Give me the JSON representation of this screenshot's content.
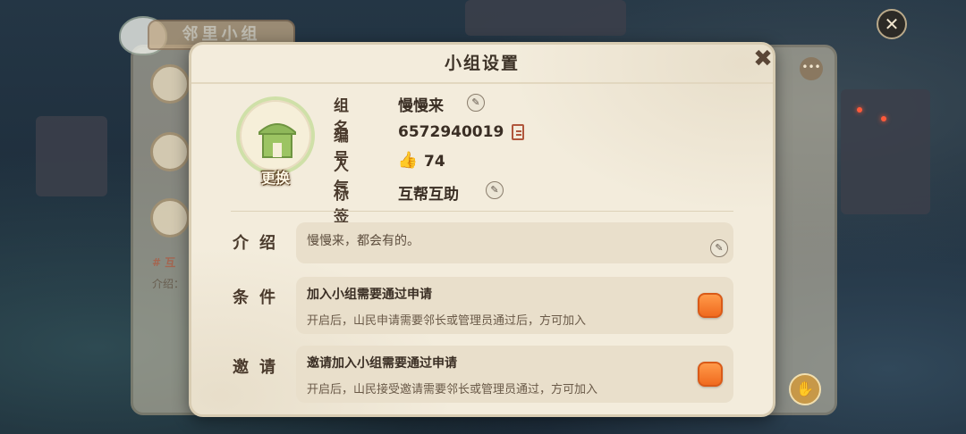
{
  "background": {
    "group_tab_label": "邻里小组",
    "partial_tag": "# 互",
    "partial_intro_label": "介绍："
  },
  "dialog": {
    "title": "小组设置",
    "avatar_change_label": "更换",
    "info": {
      "name_label": "组名",
      "name_value": "慢慢来",
      "id_label": "编号",
      "id_value": "6572940019",
      "popularity_label": "人气",
      "popularity_value": "74",
      "tag_label": "标签",
      "tag_value": "互帮互助"
    },
    "intro": {
      "label": "介绍",
      "text": "慢慢来，都会有的。"
    },
    "condition": {
      "label": "条件",
      "title": "加入小组需要通过申请",
      "desc": "开启后，山民申请需要邻长或管理员通过后，方可加入",
      "enabled": true
    },
    "invite": {
      "label": "邀请",
      "title": "邀请加入小组需要通过申请",
      "desc": "开启后，山民接受邀请需要邻长或管理员通过，方可加入",
      "enabled": true
    }
  },
  "icons": {
    "close": "close-icon",
    "edit": "pencil-icon",
    "copy": "copy-icon",
    "popularity": "thumbs-up-icon",
    "more": "more-icon",
    "handshake": "handshake-icon"
  },
  "colors": {
    "dialog_bg": "#f3ecdc",
    "toggle_on": "#f06a1e",
    "avatar_ring": "#cfe0a8",
    "house_green": "#8fb85a"
  }
}
